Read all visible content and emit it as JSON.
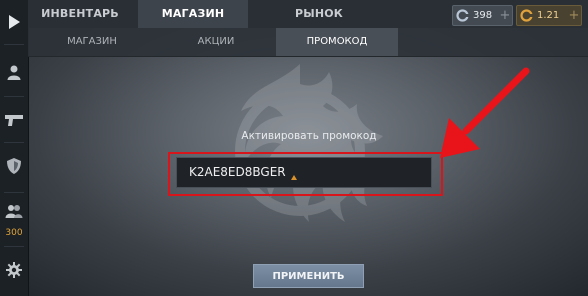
{
  "top_tabs": [
    {
      "label": "ИНВЕНТАРЬ",
      "active": false
    },
    {
      "label": "МАГАЗИН",
      "active": true
    },
    {
      "label": "РЫНОК",
      "active": false
    }
  ],
  "currencies": {
    "silver": {
      "amount": "398",
      "plus": "+",
      "icon": "silver-coin-icon",
      "color": "#b8c6d6"
    },
    "gold": {
      "amount": "1.21",
      "plus": "+",
      "icon": "gold-coin-icon",
      "color": "#e0a23c"
    }
  },
  "sub_tabs": [
    {
      "label": "МАГАЗИН",
      "active": false
    },
    {
      "label": "АКЦИИ",
      "active": false
    },
    {
      "label": "ПРОМОКОД",
      "active": true
    }
  ],
  "sidebar": {
    "items": [
      {
        "icon": "play-icon"
      },
      {
        "icon": "person-icon"
      },
      {
        "icon": "pistol-icon"
      },
      {
        "icon": "shield-icon"
      },
      {
        "icon": "friends-icon",
        "count": "300"
      },
      {
        "icon": "gear-icon"
      }
    ]
  },
  "promo": {
    "label": "Активировать промокод",
    "code": "K2AE8ED8BGER",
    "apply_label": "ПРИМЕНИТЬ"
  },
  "colors": {
    "highlight": "#d8151a",
    "accent_orange": "#e2a53a",
    "apply_button": "#7388a0"
  }
}
